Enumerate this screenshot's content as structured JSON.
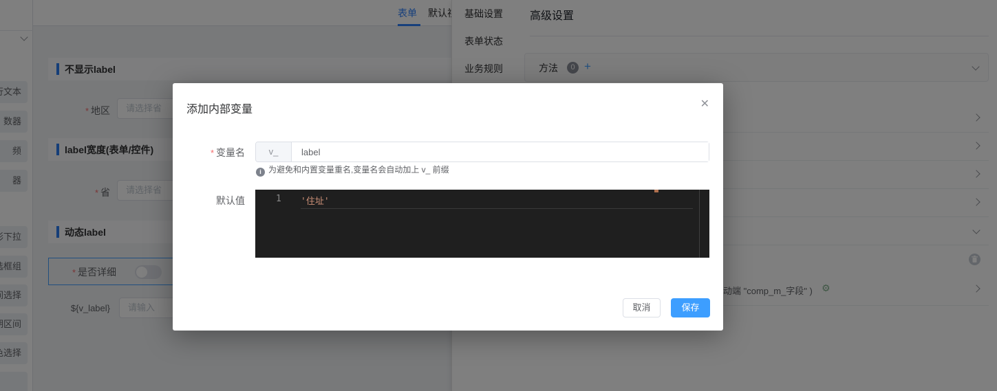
{
  "symbols": {
    "required": "*",
    "close": "✕",
    "plus": "+",
    "info": "i",
    "gear": "⚙"
  },
  "palette": {
    "items": [
      "行文本",
      "数器",
      "频",
      "器",
      "形下拉",
      "选框组",
      "间选择",
      "期区间",
      "色选择",
      ""
    ]
  },
  "canvas": {
    "tabs": [
      {
        "label": "表单",
        "active": true
      },
      {
        "label": "默认视图",
        "active": false
      }
    ],
    "sections": [
      "不显示label",
      "label宽度(表单/控件)",
      "动态label"
    ],
    "fields": [
      {
        "label": "地区",
        "placeholder": "请选择省"
      },
      {
        "label": "省",
        "placeholder": "请选择省"
      },
      {
        "label": "是否详细"
      },
      {
        "label": "${v_label}",
        "placeholder": "请输入"
      }
    ]
  },
  "settings_nav": {
    "items": [
      "基础设置",
      "表单状态",
      "业务规则"
    ]
  },
  "advanced_panel": {
    "title": "高级设置",
    "methods_label": "方法",
    "methods_count": "0",
    "binding_fragment": "动端 \"comp_m_字段\" )"
  },
  "modal": {
    "title": "添加内部变量",
    "name_label": "变量名",
    "name_prefix": "v_",
    "name_value": "label",
    "name_hint": "为避免和内置变量重名,变量名会自动加上 v_ 前缀",
    "default_label": "默认值",
    "editor": {
      "line": "1",
      "code": "'住址'"
    },
    "cancel_label": "取消",
    "save_label": "保存"
  }
}
